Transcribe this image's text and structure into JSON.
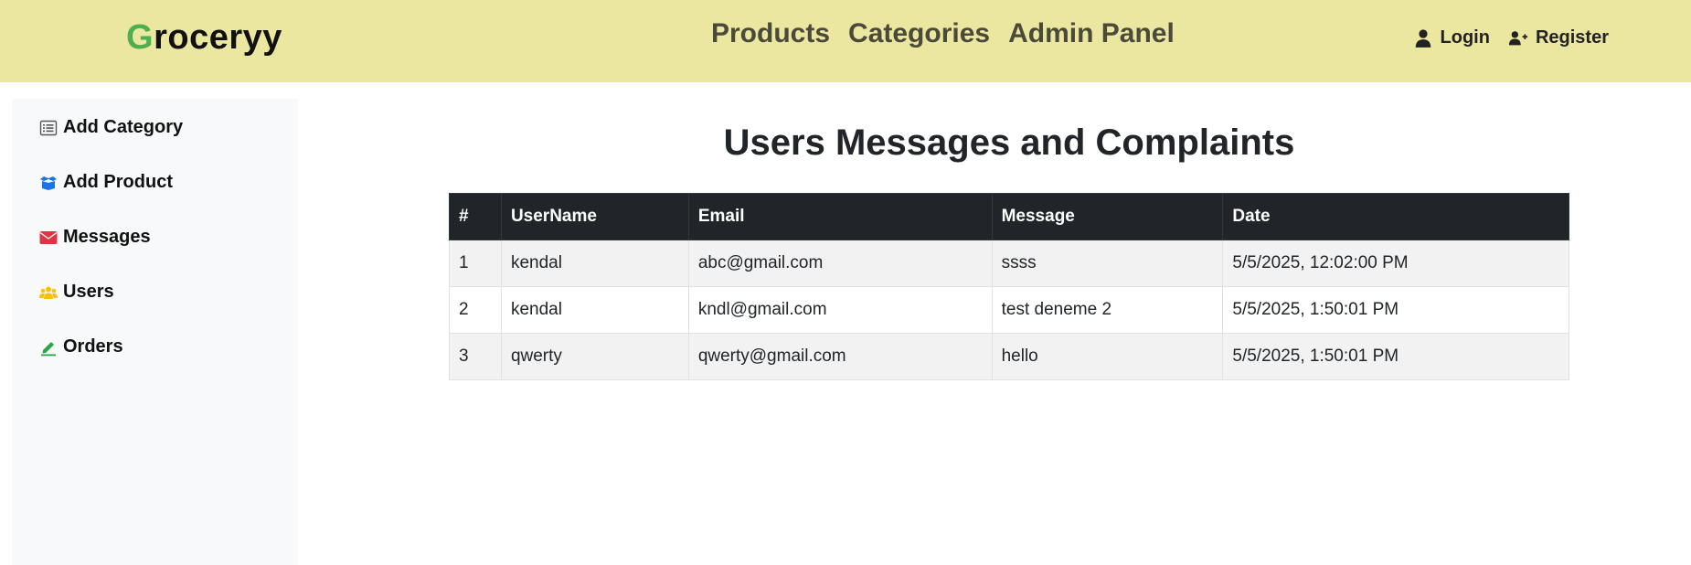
{
  "brand": {
    "first_letter": "G",
    "rest": "roceryy",
    "accent_color": "#4caf50"
  },
  "nav": {
    "links": [
      "Products",
      "Categories",
      "Admin Panel"
    ]
  },
  "auth": {
    "login_label": "Login",
    "login_icon": "user-icon",
    "register_label": "Register",
    "register_icon": "user-plus-icon"
  },
  "sidebar": {
    "items": [
      {
        "label": "Add Category",
        "icon": "list-icon",
        "color": "#555555"
      },
      {
        "label": "Add Product",
        "icon": "box-icon",
        "color": "#1a73e8"
      },
      {
        "label": "Messages",
        "icon": "envelope-icon",
        "color": "#dc3545"
      },
      {
        "label": "Users",
        "icon": "users-icon",
        "color": "#ffc107"
      },
      {
        "label": "Orders",
        "icon": "pen-icon",
        "color": "#28a745"
      }
    ]
  },
  "main": {
    "title": "Users Messages and Complaints",
    "table": {
      "headers": [
        "#",
        "UserName",
        "Email",
        "Message",
        "Date"
      ],
      "rows": [
        [
          "1",
          "kendal",
          "abc@gmail.com",
          "ssss",
          "5/5/2025, 12:02:00 PM"
        ],
        [
          "2",
          "kendal",
          "kndl@gmail.com",
          "test deneme 2",
          "5/5/2025, 1:50:01 PM"
        ],
        [
          "3",
          "qwerty",
          "qwerty@gmail.com",
          "hello",
          "5/5/2025, 1:50:01 PM"
        ]
      ]
    }
  },
  "colors": {
    "header_bg": "#ebe6a0",
    "table_header_bg": "#212529",
    "sidebar_bg": "#f8f9fa"
  }
}
